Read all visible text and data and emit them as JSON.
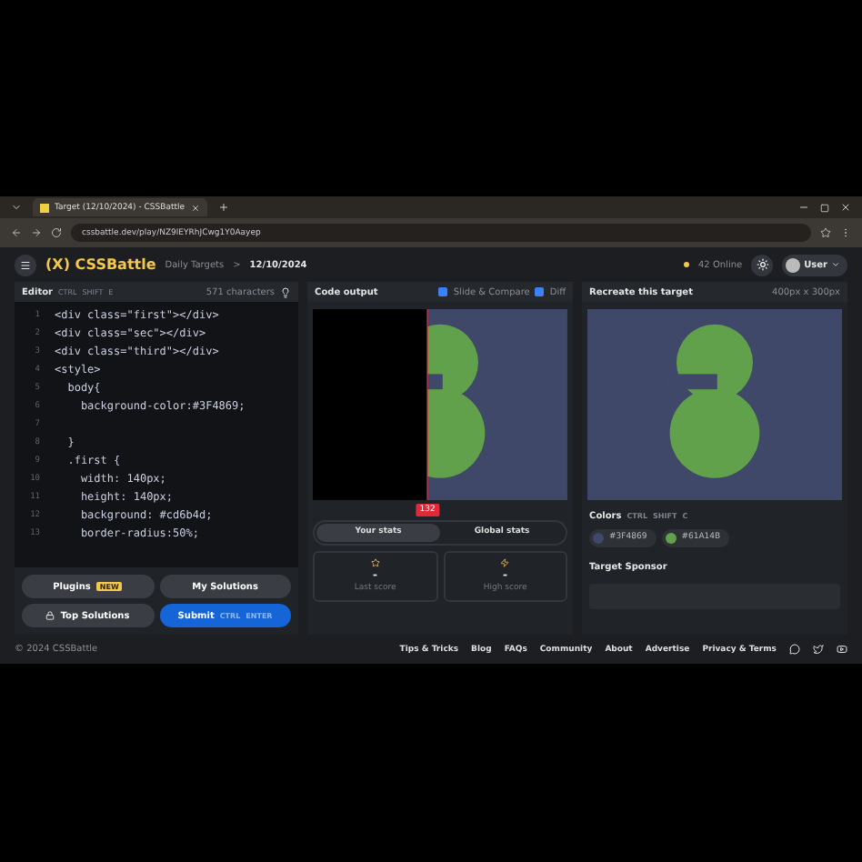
{
  "browser": {
    "tab_title": "Target (12/10/2024) - CSSBattle",
    "url": "cssbattle.dev/play/NZ9lEYRhJCwg1Y0Aayep"
  },
  "header": {
    "logo": "(X) CSSBattle",
    "breadcrumb": "Daily Targets",
    "separator": ">",
    "date": "12/10/2024",
    "online": "42 Online",
    "user": "User"
  },
  "editor": {
    "title": "Editor",
    "shortcut": [
      "CTRL",
      "SHIFT",
      "E"
    ],
    "characters": "571 characters",
    "lines": [
      {
        "num": "1",
        "code": "<div class=\"first\"></div>"
      },
      {
        "num": "2",
        "code": "<div class=\"sec\"></div>"
      },
      {
        "num": "3",
        "code": "<div class=\"third\"></div>"
      },
      {
        "num": "4",
        "code": "<style>"
      },
      {
        "num": "5",
        "code": "  body{"
      },
      {
        "num": "6",
        "code": "    background-color:#3F4869;"
      },
      {
        "num": "7"
      },
      {
        "num": "8",
        "code": "  }"
      },
      {
        "num": "9",
        "code": "  .first {"
      },
      {
        "num": "10",
        "code": "    width: 140px;"
      },
      {
        "num": "11",
        "code": "    height: 140px;"
      },
      {
        "num": "12",
        "code": "    background: #cd6b4d;"
      },
      {
        "num": "13",
        "code": "    border-radius:50%;"
      }
    ]
  },
  "actions": [
    {
      "kind": "plain",
      "label": "Plugins",
      "badge": "NEW"
    },
    {
      "kind": "plain",
      "label": "My Solutions"
    },
    {
      "kind": "locked",
      "label": "Top Solutions"
    },
    {
      "kind": "primary",
      "label": "Submit",
      "keys": [
        "CTRL",
        "ENTER"
      ]
    }
  ],
  "output": {
    "title": "Code output",
    "options": [
      {
        "label": "Slide & Compare",
        "checked": true
      },
      {
        "label": "Diff",
        "checked": true
      }
    ],
    "slider_value": "132",
    "tabs": [
      {
        "label": "Your stats",
        "selected": true
      },
      {
        "label": "Global stats",
        "selected": false
      }
    ],
    "stats": [
      {
        "kind": "star",
        "value": "-",
        "label": "Last score"
      },
      {
        "kind": "bolt",
        "value": "-",
        "label": "High score"
      }
    ]
  },
  "target": {
    "title": "Recreate this target",
    "size": "400px x 300px",
    "colors_title": "Colors",
    "shortcut": [
      "CTRL",
      "SHIFT",
      "C"
    ],
    "colors": [
      {
        "color": "#3f4869",
        "label": "#3F4869"
      },
      {
        "color": "#61a14b",
        "label": "#61A14B"
      }
    ],
    "sponsor_title": "Target Sponsor"
  },
  "footer": {
    "copyright": "© 2024 CSSBattle",
    "links": [
      "Tips & Tricks",
      "Blog",
      "FAQs",
      "Community",
      "About",
      "Advertise",
      "Privacy & Terms"
    ]
  }
}
